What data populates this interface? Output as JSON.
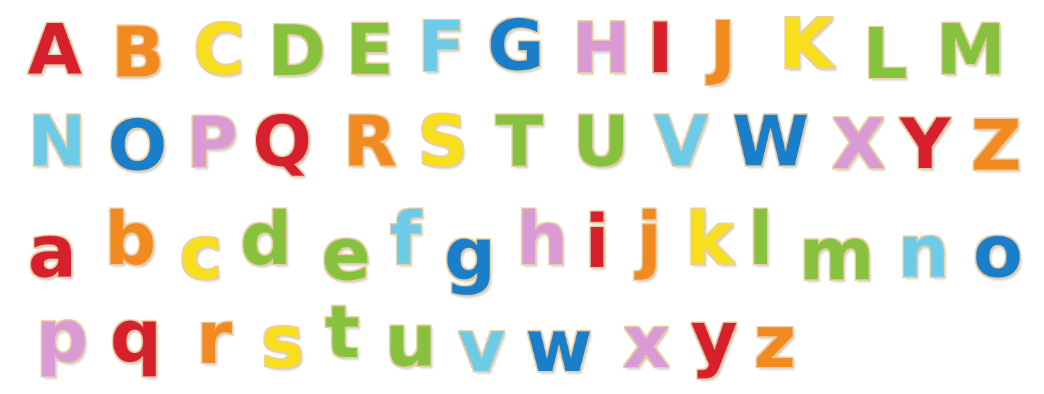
{
  "palette": {
    "red": "#d6202e",
    "orange": "#f28a22",
    "yellow": "#f7df1e",
    "green": "#86c23d",
    "lightblue": "#6ecbe8",
    "blue": "#1a7ec8",
    "pink": "#d99ad6"
  },
  "rows": {
    "upper1": [
      {
        "char": "A",
        "color": "#d6202e"
      },
      {
        "char": "B",
        "color": "#f28a22"
      },
      {
        "char": "C",
        "color": "#f7df1e"
      },
      {
        "char": "D",
        "color": "#86c23d"
      },
      {
        "char": "E",
        "color": "#86c23d"
      },
      {
        "char": "F",
        "color": "#6ecbe8"
      },
      {
        "char": "G",
        "color": "#1a7ec8"
      },
      {
        "char": "H",
        "color": "#d99ad6"
      },
      {
        "char": "I",
        "color": "#d6202e"
      },
      {
        "char": "J",
        "color": "#f28a22"
      },
      {
        "char": "K",
        "color": "#f7df1e"
      },
      {
        "char": "L",
        "color": "#86c23d"
      },
      {
        "char": "M",
        "color": "#86c23d"
      }
    ],
    "upper2": [
      {
        "char": "N",
        "color": "#6ecbe8"
      },
      {
        "char": "O",
        "color": "#1a7ec8"
      },
      {
        "char": "P",
        "color": "#d99ad6"
      },
      {
        "char": "Q",
        "color": "#d6202e"
      },
      {
        "char": "R",
        "color": "#f28a22"
      },
      {
        "char": "S",
        "color": "#f7df1e"
      },
      {
        "char": "T",
        "color": "#86c23d"
      },
      {
        "char": "U",
        "color": "#86c23d"
      },
      {
        "char": "V",
        "color": "#6ecbe8"
      },
      {
        "char": "W",
        "color": "#1a7ec8"
      },
      {
        "char": "X",
        "color": "#d99ad6"
      },
      {
        "char": "Y",
        "color": "#d6202e"
      },
      {
        "char": "Z",
        "color": "#f28a22"
      }
    ],
    "lower1": [
      {
        "char": "a",
        "color": "#d6202e"
      },
      {
        "char": "b",
        "color": "#f28a22"
      },
      {
        "char": "c",
        "color": "#f7df1e"
      },
      {
        "char": "d",
        "color": "#86c23d"
      },
      {
        "char": "e",
        "color": "#86c23d"
      },
      {
        "char": "f",
        "color": "#6ecbe8"
      },
      {
        "char": "g",
        "color": "#1a7ec8"
      },
      {
        "char": "h",
        "color": "#d99ad6"
      },
      {
        "char": "i",
        "color": "#d6202e"
      },
      {
        "char": "j",
        "color": "#f28a22"
      },
      {
        "char": "k",
        "color": "#f7df1e"
      },
      {
        "char": "l",
        "color": "#86c23d"
      },
      {
        "char": "m",
        "color": "#86c23d"
      },
      {
        "char": "n",
        "color": "#6ecbe8"
      },
      {
        "char": "o",
        "color": "#1a7ec8"
      }
    ],
    "lower2": [
      {
        "char": "p",
        "color": "#d99ad6"
      },
      {
        "char": "q",
        "color": "#d6202e"
      },
      {
        "char": "r",
        "color": "#f28a22"
      },
      {
        "char": "s",
        "color": "#f7df1e"
      },
      {
        "char": "t",
        "color": "#86c23d"
      },
      {
        "char": "u",
        "color": "#86c23d"
      },
      {
        "char": "v",
        "color": "#6ecbe8"
      },
      {
        "char": "w",
        "color": "#1a7ec8"
      },
      {
        "char": "x",
        "color": "#d99ad6"
      },
      {
        "char": "y",
        "color": "#d6202e"
      },
      {
        "char": "z",
        "color": "#f28a22"
      }
    ]
  }
}
